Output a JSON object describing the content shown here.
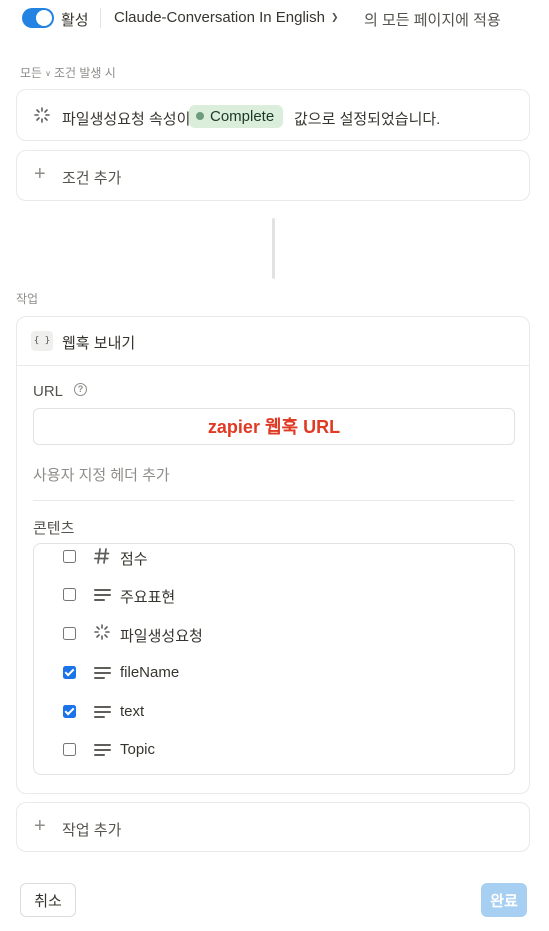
{
  "topbar": {
    "active_label": "활성",
    "page_name": "Claude-Conversation In English",
    "apply_text": "의 모든 페이지에 적용",
    "toggle_on": true
  },
  "condition": {
    "header_prefix": "모든",
    "header_suffix": "조건 발생 시",
    "property_text": "파일생성요청 속성이",
    "status_value": "Complete",
    "status_color": "#dbeddb",
    "suffix_text": "값으로 설정되었습니다.",
    "add_label": "조건 추가"
  },
  "action": {
    "section_label": "작업",
    "title": "웹훅 보내기",
    "url_label": "URL",
    "url_value": "zapier 웹훅 URL",
    "custom_header_label": "사용자 지정 헤더 추가",
    "content_label": "콘텐츠",
    "properties": [
      {
        "label": "점수",
        "icon": "hash-icon",
        "checked": false
      },
      {
        "label": "주요표현",
        "icon": "text-lines-icon",
        "checked": false
      },
      {
        "label": "파일생성요청",
        "icon": "status-spinner-icon",
        "checked": false
      },
      {
        "label": "fileName",
        "icon": "text-lines-icon",
        "checked": true
      },
      {
        "label": "text",
        "icon": "text-lines-icon",
        "checked": true
      },
      {
        "label": "Topic",
        "icon": "text-lines-icon",
        "checked": false
      }
    ],
    "add_label": "작업 추가"
  },
  "footer": {
    "cancel_label": "취소",
    "done_label": "완료"
  },
  "colors": {
    "accent": "#2383e2",
    "checkbox": "#1a73e8",
    "url_text": "#e03a25",
    "done_disabled": "#a7cff2"
  }
}
